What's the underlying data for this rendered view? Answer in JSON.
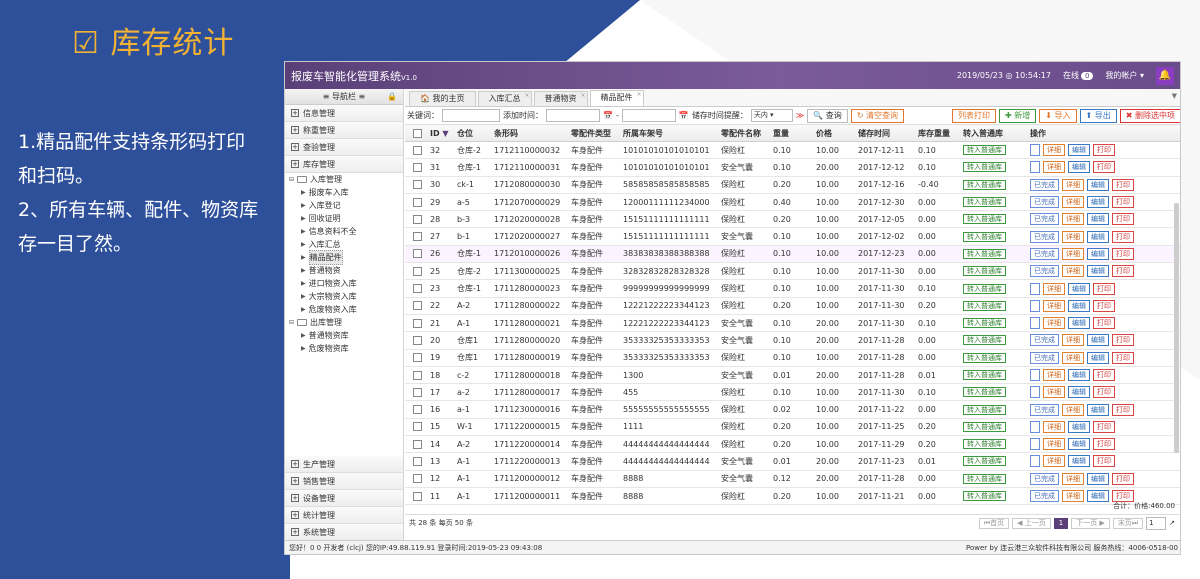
{
  "slide": {
    "title": "库存统计",
    "title_icon": "checkbox-icon",
    "lines": [
      "1.精品配件支持条形码打印",
      "和扫码。",
      "2、所有车辆、配件、物资库",
      "存一目了然。"
    ],
    "colors": {
      "blue": "#2e4f9a",
      "accent": "#f2b233"
    }
  },
  "app": {
    "title": "报废车智能化管理系统",
    "version": "V1.0",
    "datetime": "2019/05/23 ◎ 10:54:17",
    "online_label": "在线",
    "online_count": "0",
    "account": "我的帐户 ▾",
    "bell": "🔔"
  },
  "sidebar": {
    "header": "≡ 导航栏 ≡",
    "top_items": [
      "信息管理",
      "称重管理",
      "查验管理",
      "库存管理"
    ],
    "tree": {
      "in_group": "入库管理",
      "in_items": [
        "报废车入库",
        "入库登记",
        "回收证明",
        "信息资料不全",
        "入库汇总",
        "精品配件",
        "普通物资",
        "进口物资入库",
        "大宗物资入库",
        "危废物资入库"
      ],
      "out_group": "出库管理",
      "out_items": [
        "普通物资库",
        "危废物资库"
      ]
    },
    "bottom_items": [
      "生产管理",
      "销售管理",
      "设备管理",
      "统计管理",
      "系统管理"
    ]
  },
  "tabs": {
    "home": "我的主页",
    "items": [
      "入库汇总",
      "普通物资",
      "精品配件"
    ]
  },
  "filter": {
    "keyword_label": "关键词：",
    "added_label": "添加时间：",
    "remind_label": "储存时间提醒：",
    "remind_value": "天内",
    "search": "查询",
    "clear": "清空查询",
    "print_list": "列表打印",
    "add": "新增",
    "import": "导入",
    "export": "导出",
    "delete_selected": "删除选中项"
  },
  "table": {
    "headers": [
      "ID",
      "仓位",
      "条形码",
      "零配件类型",
      "所属车架号",
      "零配件名称",
      "重量",
      "价格",
      "储存时间",
      "库存重量",
      "转入普通库",
      "操作"
    ],
    "btn_into": "转入普通库",
    "btn_done": "已完成",
    "btn_detail": "详细",
    "btn_edit": "编辑",
    "btn_print": "打印",
    "rows": [
      {
        "id": "32",
        "pos": "仓库-2",
        "bar": "1712110000032",
        "type": "车身配件",
        "vin": "10101010101010101",
        "name": "保险杠",
        "wt": "0.10",
        "price": "10.00",
        "time": "2017-12-11",
        "stock": "0.10",
        "done": false,
        "print_btn": false
      },
      {
        "id": "31",
        "pos": "仓库-1",
        "bar": "1712110000031",
        "type": "车身配件",
        "vin": "10101010101010101",
        "name": "安全气囊",
        "wt": "0.10",
        "price": "20.00",
        "time": "2017-12-12",
        "stock": "0.10",
        "done": false,
        "print_btn": false
      },
      {
        "id": "30",
        "pos": "ck-1",
        "bar": "1712080000030",
        "type": "车身配件",
        "vin": "58585858585858585",
        "name": "保险杠",
        "wt": "0.20",
        "price": "10.00",
        "time": "2017-12-16",
        "stock": "-0.40",
        "done": true,
        "print_btn": true
      },
      {
        "id": "29",
        "pos": "a-5",
        "bar": "1712070000029",
        "type": "车身配件",
        "vin": "12000111111234000",
        "name": "保险杠",
        "wt": "0.40",
        "price": "10.00",
        "time": "2017-12-30",
        "stock": "0.00",
        "done": true,
        "print_btn": true
      },
      {
        "id": "28",
        "pos": "b-3",
        "bar": "1712020000028",
        "type": "车身配件",
        "vin": "15151111111111111",
        "name": "保险杠",
        "wt": "0.20",
        "price": "10.00",
        "time": "2017-12-05",
        "stock": "0.00",
        "done": true,
        "print_btn": true
      },
      {
        "id": "27",
        "pos": "b-1",
        "bar": "1712020000027",
        "type": "车身配件",
        "vin": "15151111111111111",
        "name": "安全气囊",
        "wt": "0.10",
        "price": "10.00",
        "time": "2017-12-02",
        "stock": "0.00",
        "done": true,
        "print_btn": true
      },
      {
        "id": "26",
        "pos": "仓库-1",
        "bar": "1712010000026",
        "type": "车身配件",
        "vin": "38383838388388388",
        "name": "保险杠",
        "wt": "0.10",
        "price": "10.00",
        "time": "2017-12-23",
        "stock": "0.00",
        "done": true,
        "print_btn": true
      },
      {
        "id": "25",
        "pos": "仓库-2",
        "bar": "1711300000025",
        "type": "车身配件",
        "vin": "32832832828328328",
        "name": "保险杠",
        "wt": "0.10",
        "price": "10.00",
        "time": "2017-11-30",
        "stock": "0.00",
        "done": true,
        "print_btn": true
      },
      {
        "id": "23",
        "pos": "仓库-1",
        "bar": "1711280000023",
        "type": "车身配件",
        "vin": "99999999999999999",
        "name": "保险杠",
        "wt": "0.10",
        "price": "10.00",
        "time": "2017-11-30",
        "stock": "0.10",
        "done": false,
        "print_btn": false
      },
      {
        "id": "22",
        "pos": "A-2",
        "bar": "1711280000022",
        "type": "车身配件",
        "vin": "12221222223344123",
        "name": "保险杠",
        "wt": "0.20",
        "price": "10.00",
        "time": "2017-11-30",
        "stock": "0.20",
        "done": false,
        "print_btn": false
      },
      {
        "id": "21",
        "pos": "A-1",
        "bar": "1711280000021",
        "type": "车身配件",
        "vin": "12221222223344123",
        "name": "安全气囊",
        "wt": "0.10",
        "price": "20.00",
        "time": "2017-11-30",
        "stock": "0.10",
        "done": false,
        "print_btn": false
      },
      {
        "id": "20",
        "pos": "仓库1",
        "bar": "1711280000020",
        "type": "车身配件",
        "vin": "35333325353333353",
        "name": "安全气囊",
        "wt": "0.10",
        "price": "20.00",
        "time": "2017-11-28",
        "stock": "0.00",
        "done": true,
        "print_btn": true
      },
      {
        "id": "19",
        "pos": "仓库1",
        "bar": "1711280000019",
        "type": "车身配件",
        "vin": "35333325353333353",
        "name": "保险杠",
        "wt": "0.10",
        "price": "10.00",
        "time": "2017-11-28",
        "stock": "0.00",
        "done": true,
        "print_btn": true
      },
      {
        "id": "18",
        "pos": "c-2",
        "bar": "1711280000018",
        "type": "车身配件",
        "vin": "1300",
        "name": "安全气囊",
        "wt": "0.01",
        "price": "20.00",
        "time": "2017-11-28",
        "stock": "0.01",
        "done": false,
        "print_btn": false
      },
      {
        "id": "17",
        "pos": "a-2",
        "bar": "1711280000017",
        "type": "车身配件",
        "vin": "455",
        "name": "保险杠",
        "wt": "0.10",
        "price": "10.00",
        "time": "2017-11-30",
        "stock": "0.10",
        "done": false,
        "print_btn": false
      },
      {
        "id": "16",
        "pos": "a-1",
        "bar": "1711230000016",
        "type": "车身配件",
        "vin": "55555555555555555",
        "name": "保险杠",
        "wt": "0.02",
        "price": "10.00",
        "time": "2017-11-22",
        "stock": "0.00",
        "done": true,
        "print_btn": true
      },
      {
        "id": "15",
        "pos": "W-1",
        "bar": "1711220000015",
        "type": "车身配件",
        "vin": "1111",
        "name": "保险杠",
        "wt": "0.20",
        "price": "10.00",
        "time": "2017-11-25",
        "stock": "0.20",
        "done": false,
        "print_btn": false
      },
      {
        "id": "14",
        "pos": "A-2",
        "bar": "1711220000014",
        "type": "车身配件",
        "vin": "44444444444444444",
        "name": "保险杠",
        "wt": "0.20",
        "price": "10.00",
        "time": "2017-11-29",
        "stock": "0.20",
        "done": false,
        "print_btn": false
      },
      {
        "id": "13",
        "pos": "A-1",
        "bar": "1711220000013",
        "type": "车身配件",
        "vin": "44444444444444444",
        "name": "安全气囊",
        "wt": "0.01",
        "price": "20.00",
        "time": "2017-11-23",
        "stock": "0.01",
        "done": false,
        "print_btn": false
      },
      {
        "id": "12",
        "pos": "A-1",
        "bar": "1711200000012",
        "type": "车身配件",
        "vin": "8888",
        "name": "安全气囊",
        "wt": "0.12",
        "price": "20.00",
        "time": "2017-11-28",
        "stock": "0.00",
        "done": true,
        "print_btn": true
      },
      {
        "id": "11",
        "pos": "A-1",
        "bar": "1711200000011",
        "type": "车身配件",
        "vin": "8888",
        "name": "保险杠",
        "wt": "0.20",
        "price": "10.00",
        "time": "2017-11-21",
        "stock": "0.00",
        "done": true,
        "print_btn": true
      }
    ]
  },
  "footer": {
    "total": "合计：价格:460.00",
    "summary": "共 28 条 每页 50 条",
    "first": "首页",
    "prev": "上一页",
    "current_page": "1",
    "next": "下一页",
    "last": "末页",
    "goto_value": "1"
  },
  "status": {
    "left": "您好！0 0 开发者 (clcj) 您的IP:49.88.119.91 登录时间:2019-05-23 09:43:08",
    "right": "Power by 连云港三众软件科技有限公司 服务热线：4006-0518-00"
  }
}
